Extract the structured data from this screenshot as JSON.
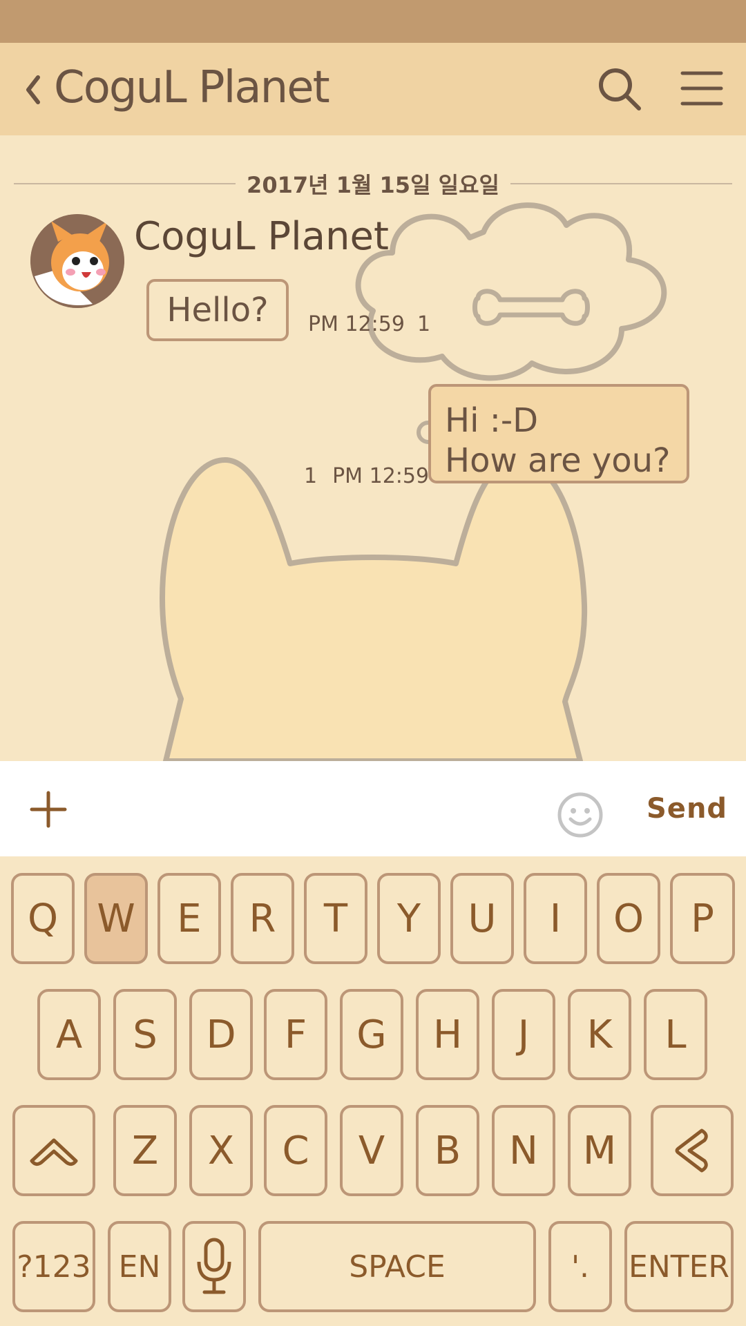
{
  "header": {
    "title": "CoguL Planet"
  },
  "chat": {
    "date": "2017년 1월 15일 일요일",
    "incoming": {
      "sender": "CoguL Planet",
      "text": "Hello?",
      "time": "PM 12:59",
      "unread": "1"
    },
    "outgoing": {
      "lines": [
        "Hi :-D",
        "How are you?"
      ],
      "time": "PM 12:59",
      "unread": "1"
    }
  },
  "input": {
    "send_label": "Send"
  },
  "keyboard": {
    "row1": [
      "Q",
      "W",
      "E",
      "R",
      "T",
      "Y",
      "U",
      "I",
      "O",
      "P"
    ],
    "row2": [
      "A",
      "S",
      "D",
      "F",
      "G",
      "H",
      "J",
      "K",
      "L"
    ],
    "row3": [
      "Z",
      "X",
      "C",
      "V",
      "B",
      "N",
      "M"
    ],
    "numbers_label": "?123",
    "lang_label": "EN",
    "space_label": "SPACE",
    "punct_label": "'.",
    "enter_label": "ENTER",
    "pressed_key": "W"
  },
  "colors": {
    "accent": "#8b5a2b",
    "header_bg": "#f0d3a3",
    "status_bar": "#c19a6f",
    "chat_bg": "#f7e6c4"
  }
}
